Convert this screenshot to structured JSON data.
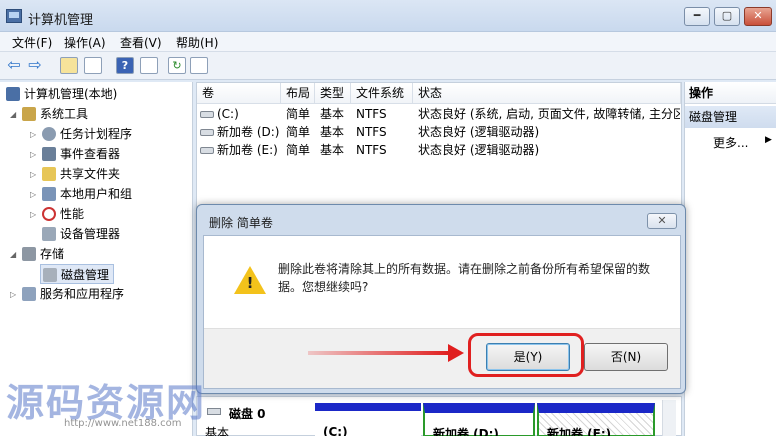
{
  "window": {
    "title": "计算机管理",
    "controls": {
      "minimize": "━",
      "maximize": "▢",
      "close": "✕"
    }
  },
  "menu": [
    "文件(F)",
    "操作(A)",
    "查看(V)",
    "帮助(H)"
  ],
  "toolbar": {
    "back": "⇦",
    "forward": "⇨",
    "help": "?",
    "refresh": "↻"
  },
  "tree": {
    "root": "计算机管理(本地)",
    "system_tools": "系统工具",
    "task_scheduler": "任务计划程序",
    "event_viewer": "事件查看器",
    "shared_folders": "共享文件夹",
    "local_users": "本地用户和组",
    "performance": "性能",
    "device_manager": "设备管理器",
    "storage": "存储",
    "disk_management": "磁盘管理",
    "services_apps": "服务和应用程序"
  },
  "volumes": {
    "headers": [
      "卷",
      "布局",
      "类型",
      "文件系统",
      "状态"
    ],
    "rows": [
      {
        "name": "(C:)",
        "layout": "简单",
        "type": "基本",
        "fs": "NTFS",
        "status": "状态良好 (系统, 启动, 页面文件, 故障转储, 主分区)"
      },
      {
        "name": "新加卷 (D:)",
        "layout": "简单",
        "type": "基本",
        "fs": "NTFS",
        "status": "状态良好 (逻辑驱动器)"
      },
      {
        "name": "新加卷 (E:)",
        "layout": "简单",
        "type": "基本",
        "fs": "NTFS",
        "status": "状态良好 (逻辑驱动器)"
      }
    ]
  },
  "actions": {
    "header": "操作",
    "section": "磁盘管理",
    "more": "更多...",
    "more_arrow": "▶"
  },
  "diskmap": {
    "disk_label": "磁盘 0",
    "disk_sub": "基本",
    "part_c": "(C:)",
    "part_d": "新加卷 (D:)",
    "part_e": "新加卷 (E:)"
  },
  "dialog": {
    "title": "删除 简单卷",
    "close": "✕",
    "message": "删除此卷将清除其上的所有数据。请在删除之前备份所有希望保留的数据。您想继续吗?",
    "warn_mark": "!",
    "yes": "是(Y)",
    "no": "否(N)"
  },
  "watermark": {
    "text": "源码资源网",
    "url": "http://www.net188.com"
  },
  "colors": {
    "primary_partition": "#1b28c7",
    "selected_border": "#2a9a2a",
    "highlight": "#e02020",
    "warning": "#f3c21b"
  }
}
